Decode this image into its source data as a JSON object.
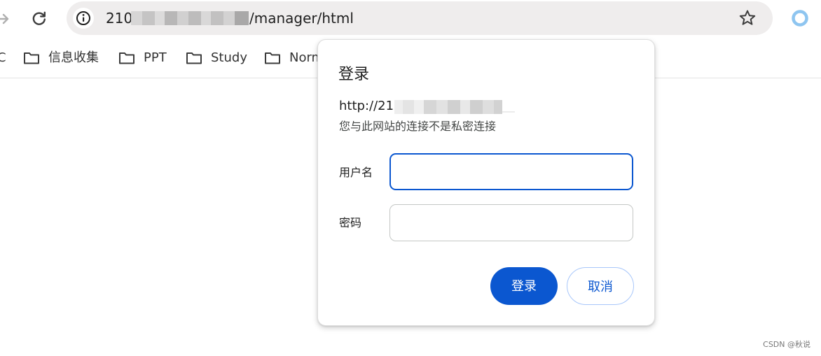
{
  "toolbar": {
    "url_host": "210",
    "url_path": "/manager/html"
  },
  "bookmarks": {
    "cut_label": "C",
    "items": [
      {
        "label": "信息收集"
      },
      {
        "label": "PPT"
      },
      {
        "label": "Study"
      },
      {
        "label": "Norm"
      }
    ]
  },
  "dialog": {
    "title": "登录",
    "url": "http://210",
    "note": "您与此网站的连接不是私密连接",
    "username_label": "用户名",
    "username_value": "",
    "password_label": "密码",
    "password_value": "",
    "login_label": "登录",
    "cancel_label": "取消"
  },
  "colors": {
    "accent": "#0b57d0",
    "omnibox_bg": "#efeded",
    "outline_light": "#a8c7fa"
  },
  "icons": {
    "forward": "forward-arrow-icon",
    "reload": "reload-icon",
    "site_info": "info-icon",
    "bookmark": "star-outline-icon",
    "profile": "profile-ring-icon",
    "folder": "folder-icon"
  },
  "watermark": "CSDN @秋说"
}
